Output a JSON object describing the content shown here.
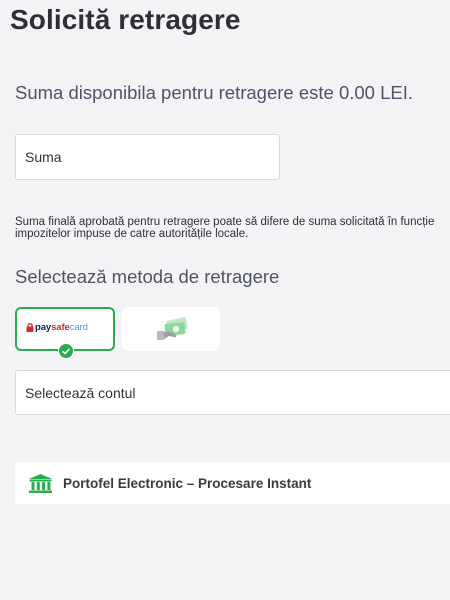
{
  "page": {
    "title": "Solicită retragere"
  },
  "balance": {
    "text": "Suma disponibila pentru retragere este 0.00 LEI."
  },
  "amount": {
    "placeholder": "Suma",
    "value": ""
  },
  "disclaimer": {
    "line1": "Suma finală aprobată pentru retragere poate să difere de suma solicitată în funcție",
    "line2": "impozitelor impuse de catre autoritățile locale."
  },
  "methods": {
    "heading": "Selectează metoda de retragere",
    "items": [
      {
        "id": "paysafecard",
        "logo_pay": "pay",
        "logo_safe": "safe",
        "logo_card": "card",
        "selected": true,
        "icon": "paysafecard-logo"
      },
      {
        "id": "e-wallet",
        "selected": false,
        "icon": "cash-wallet-icon"
      }
    ]
  },
  "account": {
    "selected_label": "Selectează contul"
  },
  "processing": {
    "label": "Portofel Electronic – Procesare Instant",
    "icon": "bank-icon"
  },
  "colors": {
    "accent_green": "#27ae4f",
    "background": "#f4f4f6",
    "paysafe_red": "#d62b2f",
    "paysafe_navy": "#0f1d4d",
    "paysafe_blue": "#4aa0d8"
  }
}
